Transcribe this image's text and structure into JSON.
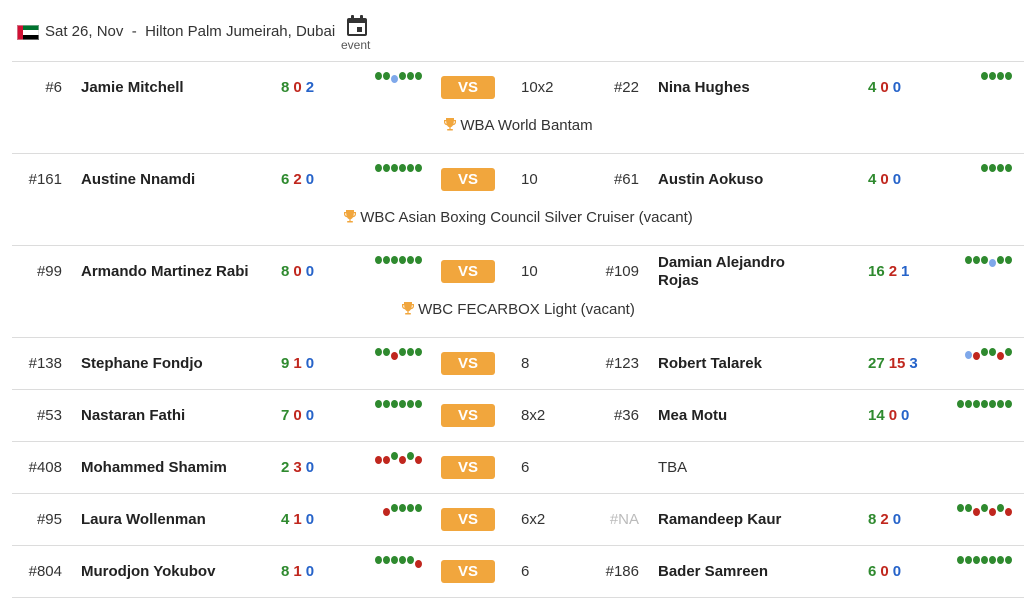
{
  "event": {
    "date": "Sat 26, Nov",
    "separator": "-",
    "venue": "Hilton Palm Jumeirah, Dubai",
    "event_label": "event"
  },
  "colors": {
    "win": "#2f8a2f",
    "loss": "#c0271e",
    "draw": "#2663c9",
    "vs_badge": "#f1a63d",
    "trophy": "#f1a63d"
  },
  "icons": {
    "flag": "uae-flag-icon",
    "calendar": "calendar-icon",
    "trophy": "trophy-icon"
  },
  "vs_label": "VS",
  "fights": [
    {
      "left": {
        "rank": "#6",
        "name": "Jamie Mitchell",
        "w": "8",
        "l": "0",
        "d": "2",
        "form": [
          "w",
          "w",
          "d",
          "w",
          "w",
          "w"
        ]
      },
      "rounds": "10x2",
      "right": {
        "rank": "#22",
        "name": "Nina Hughes",
        "w": "4",
        "l": "0",
        "d": "0",
        "form": [
          "w",
          "w",
          "w",
          "w"
        ]
      },
      "title": "WBA World Bantam"
    },
    {
      "left": {
        "rank": "#161",
        "name": "Austine Nnamdi",
        "w": "6",
        "l": "2",
        "d": "0",
        "form": [
          "w",
          "w",
          "w",
          "w",
          "w",
          "w"
        ]
      },
      "rounds": "10",
      "right": {
        "rank": "#61",
        "name": "Austin Aokuso",
        "w": "4",
        "l": "0",
        "d": "0",
        "form": [
          "w",
          "w",
          "w",
          "w"
        ]
      },
      "title": "WBC Asian Boxing Council Silver Cruiser (vacant)"
    },
    {
      "left": {
        "rank": "#99",
        "name": "Armando Martinez Rabi",
        "w": "8",
        "l": "0",
        "d": "0",
        "form": [
          "w",
          "w",
          "w",
          "w",
          "w",
          "w"
        ]
      },
      "rounds": "10",
      "right": {
        "rank": "#109",
        "name": "Damian Alejandro Rojas",
        "w": "16",
        "l": "2",
        "d": "1",
        "form": [
          "w",
          "w",
          "w",
          "d",
          "w",
          "w"
        ]
      },
      "title": "WBC FECARBOX Light (vacant)"
    },
    {
      "left": {
        "rank": "#138",
        "name": "Stephane Fondjo",
        "w": "9",
        "l": "1",
        "d": "0",
        "form": [
          "w",
          "w",
          "l",
          "w",
          "w",
          "w"
        ]
      },
      "rounds": "8",
      "right": {
        "rank": "#123",
        "name": "Robert Talarek",
        "w": "27",
        "l": "15",
        "d": "3",
        "form": [
          "d",
          "l",
          "w",
          "w",
          "l",
          "w"
        ]
      }
    },
    {
      "left": {
        "rank": "#53",
        "name": "Nastaran Fathi",
        "w": "7",
        "l": "0",
        "d": "0",
        "form": [
          "w",
          "w",
          "w",
          "w",
          "w",
          "w"
        ]
      },
      "rounds": "8x2",
      "right": {
        "rank": "#36",
        "name": "Mea Motu",
        "w": "14",
        "l": "0",
        "d": "0",
        "form": [
          "w",
          "w",
          "w",
          "w",
          "w",
          "w",
          "w"
        ]
      }
    },
    {
      "left": {
        "rank": "#408",
        "name": "Mohammed Shamim",
        "w": "2",
        "l": "3",
        "d": "0",
        "form": [
          "l",
          "l",
          "w",
          "l",
          "w",
          "l"
        ]
      },
      "rounds": "6",
      "right": {
        "tba": "TBA"
      }
    },
    {
      "left": {
        "rank": "#95",
        "name": "Laura Wollenman",
        "w": "4",
        "l": "1",
        "d": "0",
        "form": [
          "l",
          "w",
          "w",
          "w",
          "w"
        ]
      },
      "rounds": "6x2",
      "right": {
        "rank": "#NA",
        "name": "Ramandeep Kaur",
        "w": "8",
        "l": "2",
        "d": "0",
        "form": [
          "w",
          "w",
          "l",
          "w",
          "l",
          "w",
          "l"
        ]
      }
    },
    {
      "left": {
        "rank": "#804",
        "name": "Murodjon Yokubov",
        "w": "8",
        "l": "1",
        "d": "0",
        "form": [
          "w",
          "w",
          "w",
          "w",
          "w",
          "l"
        ]
      },
      "rounds": "6",
      "right": {
        "rank": "#186",
        "name": "Bader Samreen",
        "w": "6",
        "l": "0",
        "d": "0",
        "form": [
          "w",
          "w",
          "w",
          "w",
          "w",
          "w",
          "w"
        ]
      }
    }
  ]
}
